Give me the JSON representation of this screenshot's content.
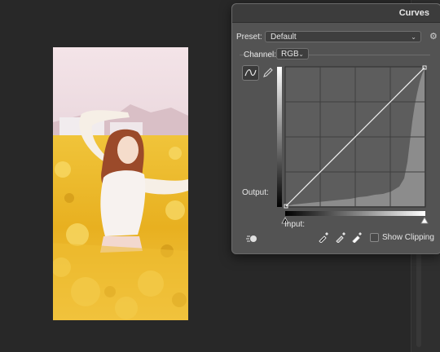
{
  "dialog": {
    "title": "Curves",
    "preset_label": "Preset:",
    "preset_value": "Default",
    "channel_label": "Channel:",
    "channel_value": "RGB",
    "output_label": "Output:",
    "input_label": "Input:",
    "show_clipping_label": "Show Clipping",
    "show_clipping_checked": false
  },
  "colors": {
    "workspace": "#282828",
    "panel": "#535353",
    "graph_bg": "#5d5d5d",
    "histogram": "#8c8c8c",
    "curve": "#f2f2f2"
  },
  "icons": {
    "curve_tool": "curve-point-icon",
    "pencil_tool": "pencil-icon",
    "auto": "auto-adjust-icon",
    "black_point": "eyedropper-black-icon",
    "gray_point": "eyedropper-gray-icon",
    "white_point": "eyedropper-white-icon",
    "menu": "gear-icon"
  }
}
